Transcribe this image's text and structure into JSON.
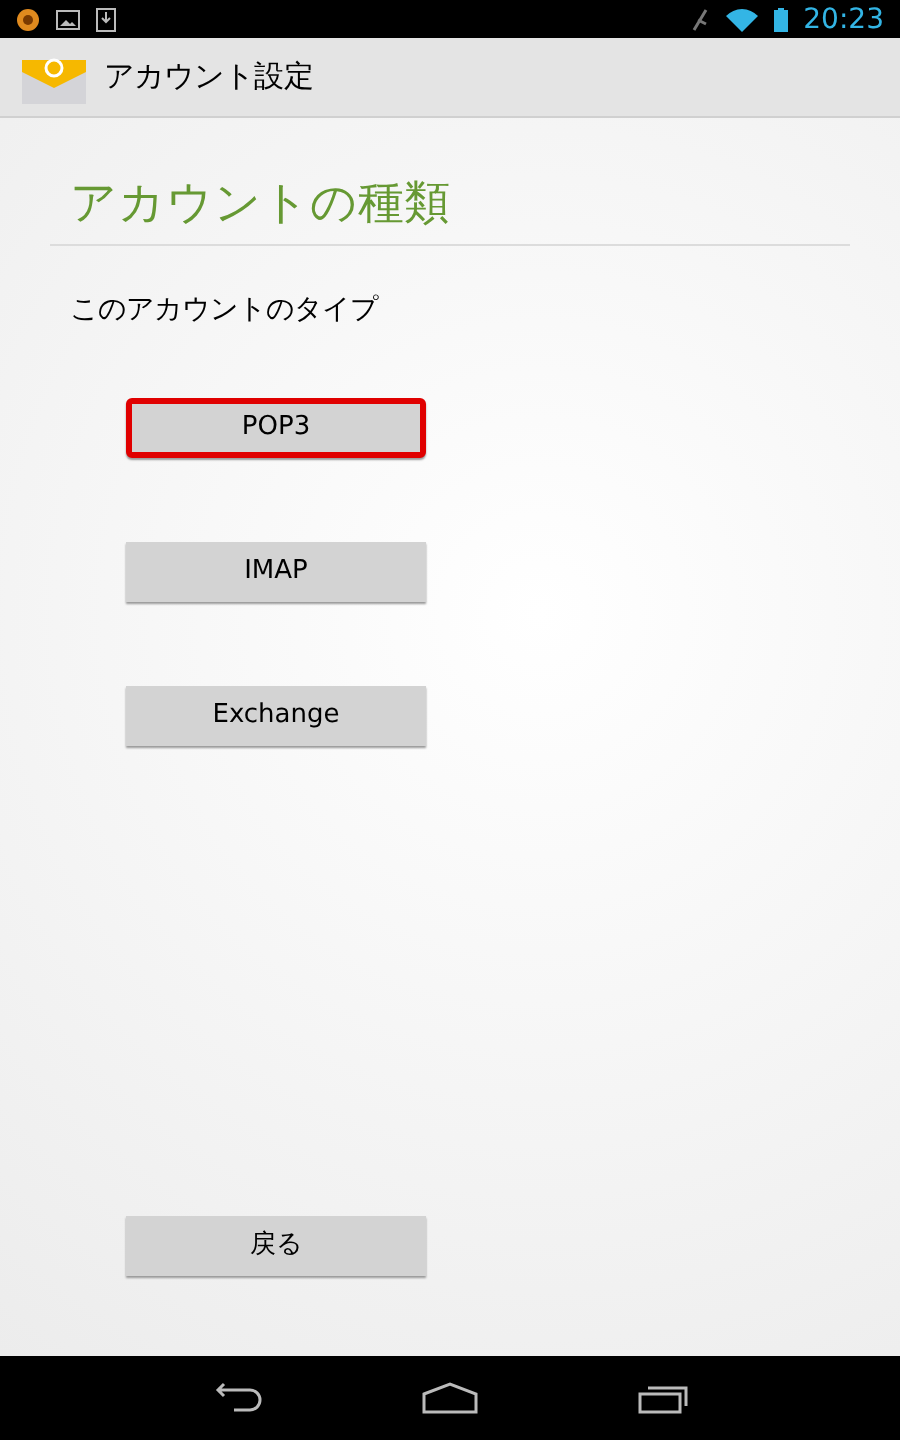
{
  "status_bar": {
    "time": "20:23"
  },
  "action_bar": {
    "title": "アカウント設定"
  },
  "heading": "アカウントの種類",
  "prompt": "このアカウントのタイプ",
  "options": [
    {
      "label": "POP3",
      "highlighted": true
    },
    {
      "label": "IMAP",
      "highlighted": false
    },
    {
      "label": "Exchange",
      "highlighted": false
    }
  ],
  "back_button": "戻る"
}
